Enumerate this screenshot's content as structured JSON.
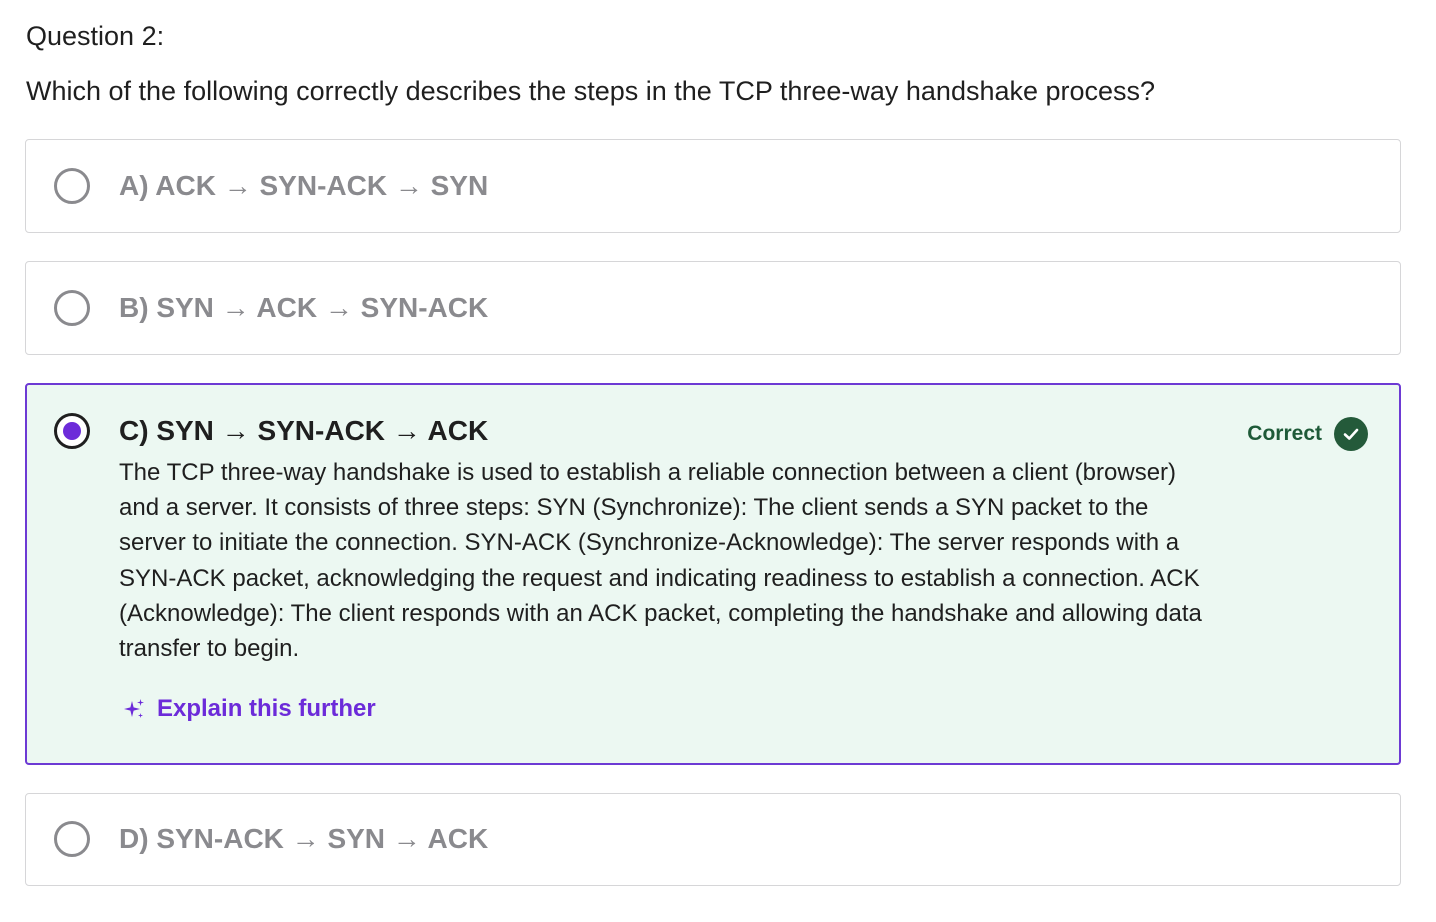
{
  "question": {
    "number_label": "Question 2:",
    "text": "Which of the following correctly describes the steps in the TCP three-way handshake process?"
  },
  "options": [
    {
      "label": "A) ACK → SYN-ACK → SYN",
      "selected": false
    },
    {
      "label": "B) SYN → ACK → SYN-ACK",
      "selected": false
    },
    {
      "label": "C) SYN → SYN-ACK → ACK",
      "selected": true,
      "status_label": "Correct",
      "status_icon": "check-circle-icon",
      "feedback": "The TCP three-way handshake is used to establish a reliable connection between a client (browser) and a server. It consists of three steps: SYN (Synchronize): The client sends a SYN packet to the server to initiate the connection. SYN-ACK (Synchronize-Acknowledge): The server responds with a SYN-ACK packet, acknowledging the request and indicating readiness to establish a connection. ACK (Acknowledge): The client responds with an ACK packet, completing the handshake and allowing data transfer to begin.",
      "explain_label": "Explain this further",
      "explain_icon": "sparkle-icon"
    },
    {
      "label": "D) SYN-ACK → SYN → ACK",
      "selected": false
    }
  ],
  "colors": {
    "accent": "#6c2bd9",
    "correct_text": "#1e5a38",
    "correct_background": "#ecf8f2",
    "unselected_text": "#8a8a8e"
  }
}
